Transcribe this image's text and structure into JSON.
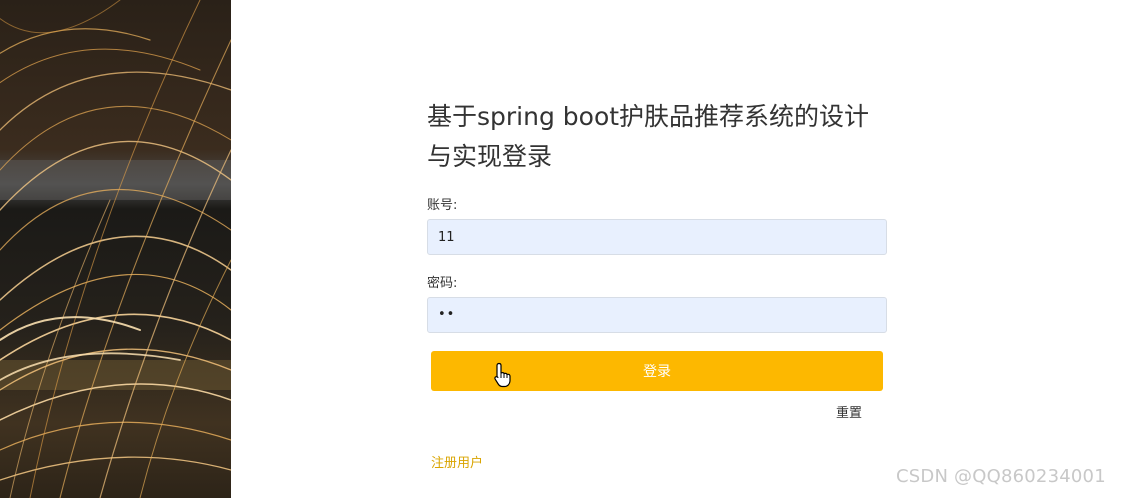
{
  "login": {
    "title": "基于spring boot护肤品推荐系统的设计与实现登录",
    "account_label": "账号:",
    "account_value": "11",
    "password_label": "密码:",
    "password_value": "••",
    "login_button": "登录",
    "reset_link": "重置",
    "register_link": "注册用户"
  },
  "watermark": "CSDN @QQ860234001",
  "colors": {
    "accent": "#fdb800",
    "input_bg": "#e8f0fe",
    "register_link": "#d9a400"
  },
  "icons": [
    "hand-pointer-cursor-icon"
  ]
}
